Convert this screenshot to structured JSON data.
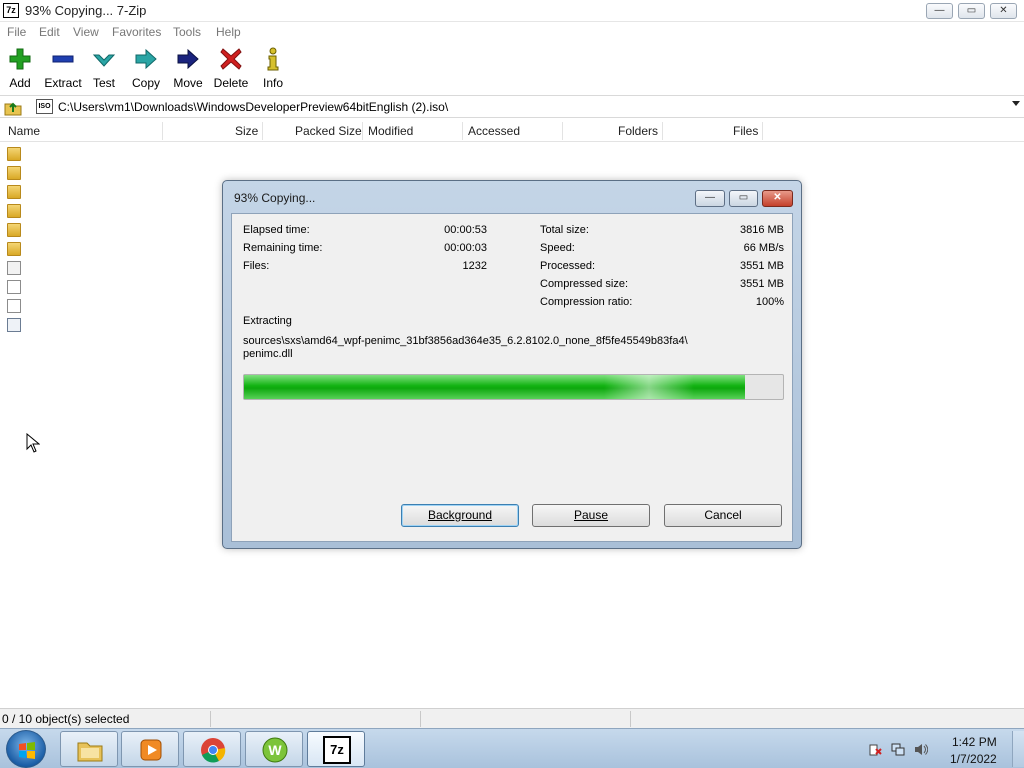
{
  "window": {
    "icon_text": "7z",
    "title": "93% Copying... 7-Zip",
    "controls": {
      "minimize": "—",
      "maximize": "▭",
      "close": "✕"
    }
  },
  "menu": [
    "File",
    "Edit",
    "View",
    "Favorites",
    "Tools",
    "Help"
  ],
  "toolbar": [
    {
      "label": "Add",
      "icon": "plus-icon",
      "color": "#22a022"
    },
    {
      "label": "Extract",
      "icon": "minus-icon",
      "color": "#1f3fb0"
    },
    {
      "label": "Test",
      "icon": "check-icon",
      "color": "#2aa5a5"
    },
    {
      "label": "Copy",
      "icon": "copy-arrow-icon",
      "color": "#2aa5a5"
    },
    {
      "label": "Move",
      "icon": "move-arrow-icon",
      "color": "#1a237e"
    },
    {
      "label": "Delete",
      "icon": "delete-x-icon",
      "color": "#d02020"
    },
    {
      "label": "Info",
      "icon": "info-icon",
      "color": "#8a7a00"
    }
  ],
  "address": {
    "path": "C:\\Users\\vm1\\Downloads\\WindowsDeveloperPreview64bitEnglish (2).iso\\",
    "icon_text": "ISO"
  },
  "columns": [
    "Name",
    "Size",
    "Packed Size",
    "Modified",
    "Accessed",
    "Folders",
    "Files"
  ],
  "file_icons": [
    "folder",
    "folder",
    "folder",
    "folder",
    "folder",
    "folder",
    "cfg",
    "doc",
    "doc",
    "img"
  ],
  "status": {
    "text": "0 / 10 object(s) selected"
  },
  "dialog": {
    "title": "93% Copying...",
    "left_stats": [
      {
        "label": "Elapsed time:",
        "value": "00:00:53"
      },
      {
        "label": "Remaining time:",
        "value": "00:00:03"
      },
      {
        "label": "Files:",
        "value": "1232"
      }
    ],
    "right_stats": [
      {
        "label": "Total size:",
        "value": "3816 MB"
      },
      {
        "label": "Speed:",
        "value": "66 MB/s"
      },
      {
        "label": "Processed:",
        "value": "3551 MB"
      },
      {
        "label": "Compressed size:",
        "value": "3551 MB"
      },
      {
        "label": "Compression ratio:",
        "value": "100%"
      }
    ],
    "operation": "Extracting",
    "current_path": "sources\\sxs\\amd64_wpf-penimc_31bf3856ad364e35_6.2.8102.0_none_8f5fe45549b83fa4\\",
    "current_file": "penimc.dll",
    "progress": 0.93,
    "progress_color": "#12b312",
    "buttons": {
      "background": "Background",
      "pause": "Pause",
      "cancel": "Cancel"
    }
  },
  "taskbar": {
    "items": [
      {
        "name": "explorer",
        "icon": "folder-icon"
      },
      {
        "name": "media-player",
        "icon": "media-player-icon"
      },
      {
        "name": "chrome",
        "icon": "chrome-icon"
      },
      {
        "name": "app-w",
        "icon": "w-app-icon"
      },
      {
        "name": "7-zip",
        "icon": "7zip-icon",
        "text": "7z"
      }
    ],
    "clock": {
      "time": "1:42 PM",
      "date": "1/7/2022"
    }
  }
}
